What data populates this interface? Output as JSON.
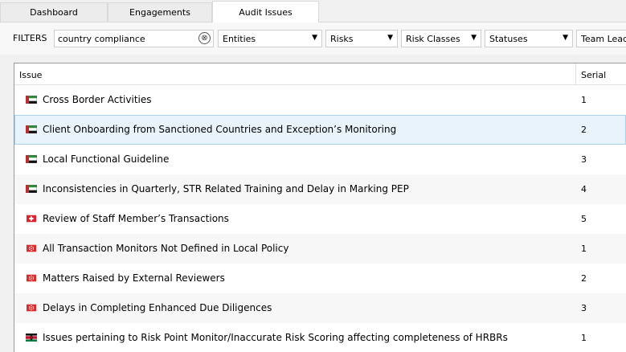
{
  "tabs": [
    {
      "label": "Dashboard"
    },
    {
      "label": "Engagements"
    },
    {
      "label": "Audit Issues",
      "active": true
    }
  ],
  "filters": {
    "label": "FILTERS",
    "search_value": "country compliance",
    "clear_symbol": "⊗",
    "dropdowns": [
      {
        "label": "Entities"
      },
      {
        "label": "Risks"
      },
      {
        "label": "Risk Classes"
      },
      {
        "label": "Statuses"
      },
      {
        "label": "Team Leads"
      }
    ]
  },
  "table": {
    "columns": [
      "Issue",
      "Serial"
    ],
    "rows": [
      {
        "flag": "uae-flag-icon",
        "issue": "Cross Border Activities",
        "serial": "1"
      },
      {
        "flag": "uae-flag-icon",
        "issue": "Client Onboarding from Sanctioned Countries and Exception’s Monitoring",
        "serial": "2",
        "selected": true
      },
      {
        "flag": "uae-flag-icon",
        "issue": "Local Functional Guideline",
        "serial": "3"
      },
      {
        "flag": "uae-flag-icon",
        "issue": "Inconsistencies in Quarterly, STR Related Training and Delay in Marking PEP",
        "serial": "4"
      },
      {
        "flag": "swiss-flag-icon",
        "issue": "Review of Staff Member’s Transactions",
        "serial": "5"
      },
      {
        "flag": "hong-kong-flag-icon",
        "issue": "All Transaction Monitors Not Defined in Local Policy",
        "serial": "1"
      },
      {
        "flag": "hong-kong-flag-icon",
        "issue": "Matters Raised by External Reviewers",
        "serial": "2"
      },
      {
        "flag": "hong-kong-flag-icon",
        "issue": "Delays in Completing Enhanced Due Diligences",
        "serial": "3"
      },
      {
        "flag": "kenya-flag-icon",
        "issue": "Issues pertaining to Risk Point Monitor/Inaccurate Risk Scoring affecting completeness of HRBRs",
        "serial": "1"
      }
    ]
  }
}
